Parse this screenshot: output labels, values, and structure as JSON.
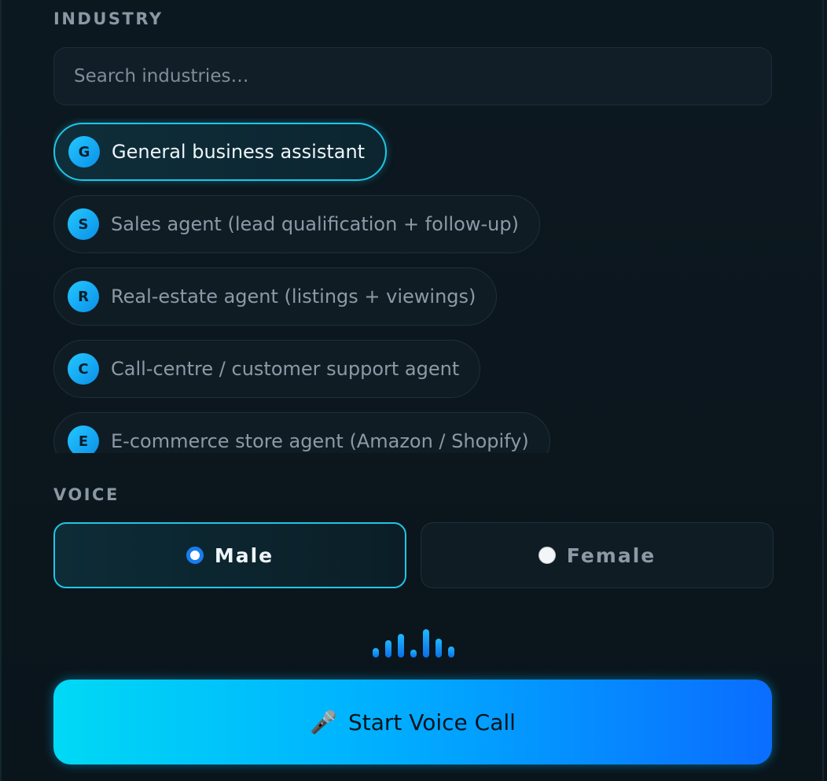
{
  "industry": {
    "label": "INDUSTRY",
    "search_placeholder": "Search industries…",
    "options": [
      {
        "initial": "G",
        "label": "General business assistant",
        "selected": true
      },
      {
        "initial": "S",
        "label": "Sales agent (lead qualification + follow-up)",
        "selected": false
      },
      {
        "initial": "R",
        "label": "Real-estate agent (listings + viewings)",
        "selected": false
      },
      {
        "initial": "C",
        "label": "Call-centre / customer support agent",
        "selected": false
      },
      {
        "initial": "E",
        "label": "E-commerce store agent (Amazon / Shopify)",
        "selected": false
      }
    ]
  },
  "voice": {
    "label": "VOICE",
    "options": [
      {
        "label": "Male",
        "selected": true
      },
      {
        "label": "Female",
        "selected": false
      }
    ]
  },
  "call_button": {
    "icon": "microphone-icon",
    "label": "Start Voice Call"
  },
  "colors": {
    "accent": "#1fc6e6",
    "radio_selected": "#1a7cf0",
    "button_gradient_start": "#00d9f5",
    "button_gradient_end": "#0a6dff"
  }
}
